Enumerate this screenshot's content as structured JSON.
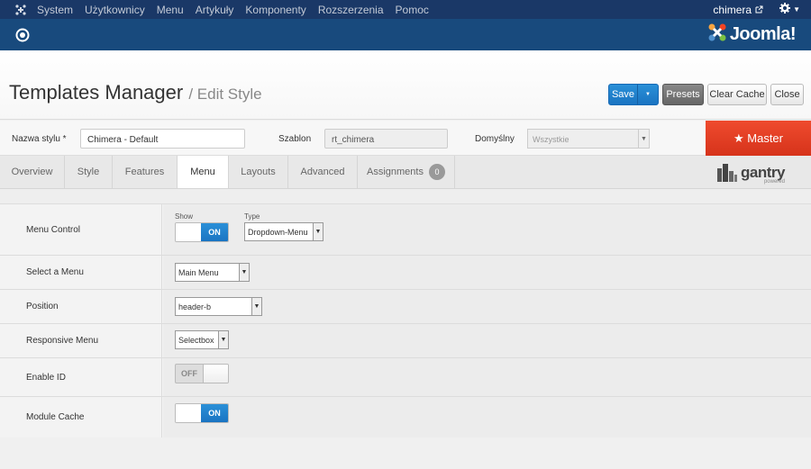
{
  "topnav": {
    "items": [
      "System",
      "Użytkownicy",
      "Menu",
      "Artykuły",
      "Komponenty",
      "Rozszerzenia",
      "Pomoc"
    ],
    "user": "chimera"
  },
  "header": {
    "brand": "Joomla!"
  },
  "title": {
    "main": "Templates Manager",
    "sub": "/ Edit Style"
  },
  "toolbar": {
    "save": "Save",
    "presets": "Presets",
    "clear_cache": "Clear Cache",
    "close": "Close"
  },
  "fields": {
    "style_name_label": "Nazwa stylu *",
    "style_name_value": "Chimera - Default",
    "template_label": "Szablon",
    "template_value": "rt_chimera",
    "default_label": "Domyślny",
    "default_value": "Wszystkie"
  },
  "master": "★ Master",
  "tabs": [
    {
      "label": "Overview"
    },
    {
      "label": "Style"
    },
    {
      "label": "Features"
    },
    {
      "label": "Menu",
      "active": true
    },
    {
      "label": "Layouts"
    },
    {
      "label": "Advanced"
    },
    {
      "label": "Assignments",
      "badge": "0"
    }
  ],
  "gantry": {
    "name": "gantry",
    "tag": "powered"
  },
  "settings": {
    "menu_control": {
      "label": "Menu Control",
      "show_label": "Show",
      "show_value": "ON",
      "type_label": "Type",
      "type_value": "Dropdown-Menu"
    },
    "select_menu": {
      "label": "Select a Menu",
      "value": "Main Menu"
    },
    "position": {
      "label": "Position",
      "value": "header-b"
    },
    "responsive": {
      "label": "Responsive Menu",
      "value": "Selectbox"
    },
    "enable_id": {
      "label": "Enable ID",
      "value": "OFF"
    },
    "module_cache": {
      "label": "Module Cache",
      "value": "ON"
    }
  },
  "colors": {
    "primary": "#1a74c2",
    "master": "#e2401f",
    "topbar": "#1a3867",
    "header": "#184a7d"
  }
}
